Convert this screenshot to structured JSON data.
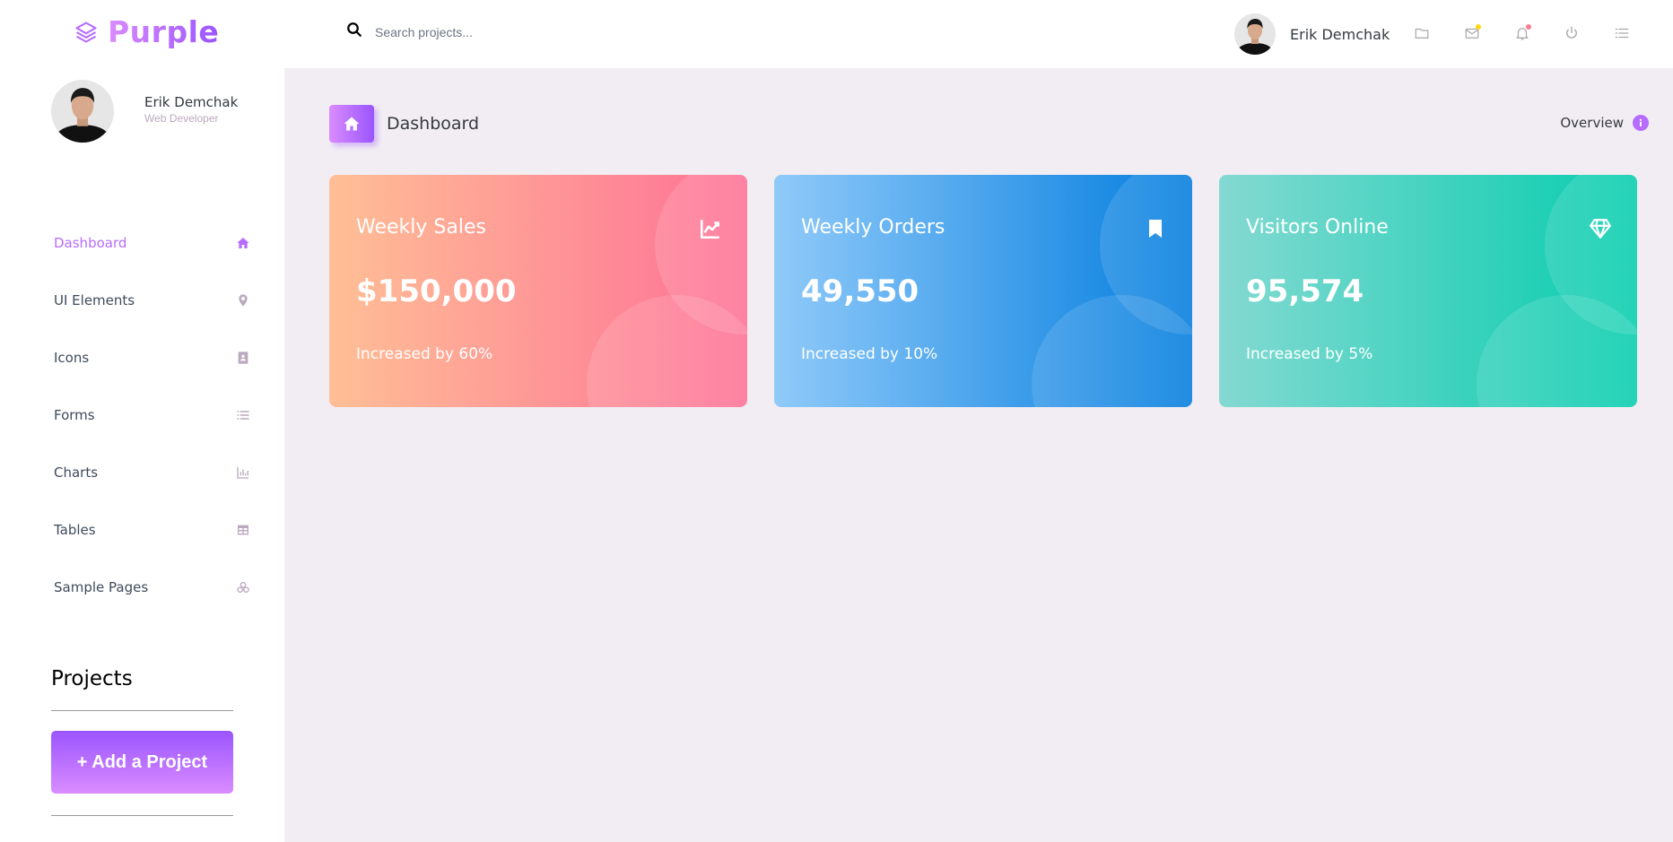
{
  "brand": {
    "name": "Purple"
  },
  "search": {
    "placeholder": "Search projects..."
  },
  "user": {
    "name": "Erik Demchak",
    "role": "Web Developer"
  },
  "navbar_icons": [
    {
      "name": "folder-icon"
    },
    {
      "name": "mail-icon",
      "indicator_color": "#fed713"
    },
    {
      "name": "bell-icon",
      "indicator_color": "#fe7c96"
    },
    {
      "name": "power-icon"
    },
    {
      "name": "list-icon"
    }
  ],
  "sidebar": {
    "items": [
      {
        "label": "Dashboard",
        "icon": "home-icon",
        "active": true
      },
      {
        "label": "UI Elements",
        "icon": "map-pin-icon"
      },
      {
        "label": "Icons",
        "icon": "contacts-icon"
      },
      {
        "label": "Forms",
        "icon": "format-list-icon"
      },
      {
        "label": "Charts",
        "icon": "chart-icon"
      },
      {
        "label": "Tables",
        "icon": "table-icon"
      },
      {
        "label": "Sample Pages",
        "icon": "medical-bag-icon"
      }
    ],
    "projects_title": "Projects",
    "add_project_label": "+ Add a Project"
  },
  "page": {
    "title": "Dashboard",
    "overview_label": "Overview"
  },
  "cards": [
    {
      "title": "Weekly Sales",
      "value": "$150,000",
      "subtitle": "Increased by 60%",
      "icon": "chart-line-icon"
    },
    {
      "title": "Weekly Orders",
      "value": "49,550",
      "subtitle": "Increased by 10%",
      "icon": "bookmark-icon"
    },
    {
      "title": "Visitors Online",
      "value": "95,574",
      "subtitle": "Increased by 5%",
      "icon": "diamond-icon"
    }
  ],
  "colors": {
    "accent": "#b66dff",
    "background": "#f2edf3",
    "sales_gradient": [
      "#ffbf96",
      "#fe7096"
    ],
    "orders_gradient": [
      "#90caf9",
      "#047edf"
    ],
    "visitors_gradient": [
      "#84d9d2",
      "#07cdae"
    ]
  }
}
